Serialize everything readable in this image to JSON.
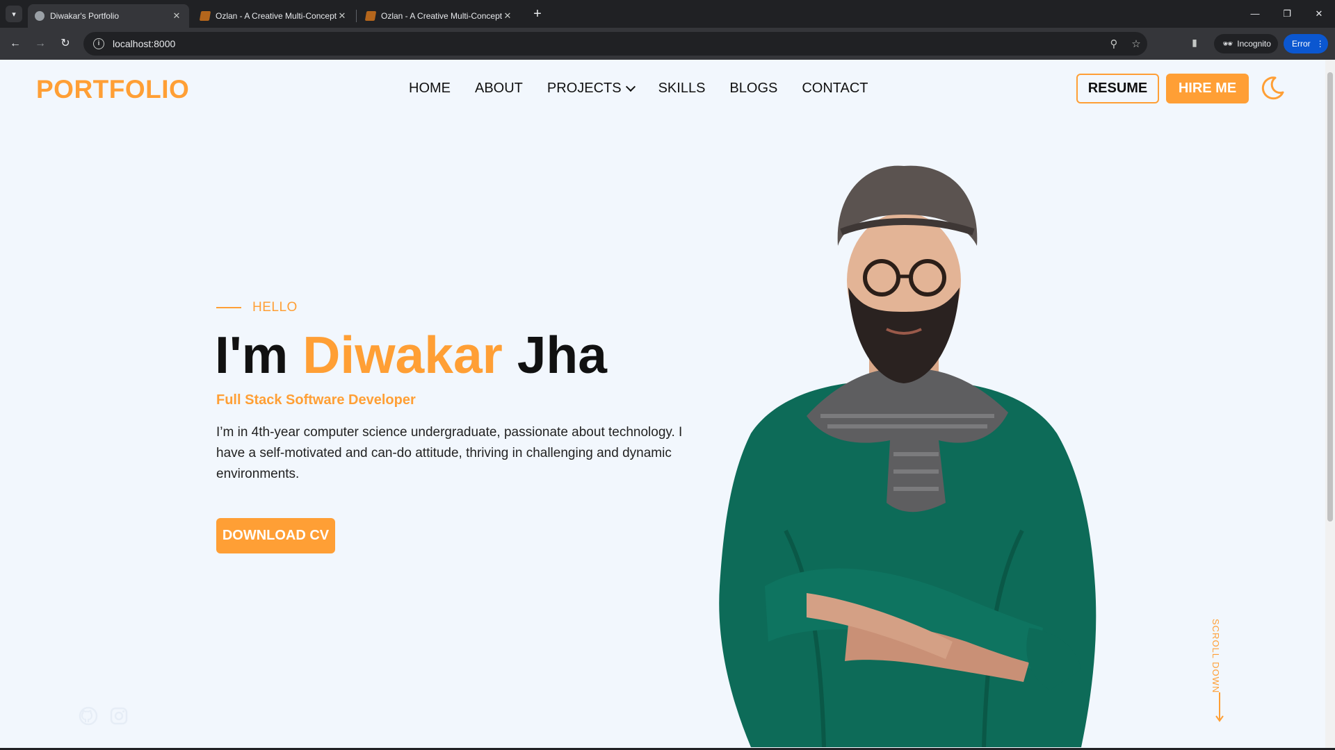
{
  "browser": {
    "tabs": [
      {
        "title": "Diwakar's Portfolio",
        "active": true
      },
      {
        "title": "Ozlan - A Creative Multi-Concept",
        "active": false
      },
      {
        "title": "Ozlan - A Creative Multi-Concept",
        "active": false
      }
    ],
    "url": "localhost:8000",
    "incognito_label": "Incognito",
    "error_label": "Error"
  },
  "header": {
    "logo": "PORTFOLIO",
    "nav": [
      "HOME",
      "ABOUT",
      "PROJECTS",
      "SKILLS",
      "BLOGS",
      "CONTACT"
    ],
    "resume_label": "RESUME",
    "hire_label": "HIRE ME"
  },
  "hero": {
    "eyebrow": "HELLO",
    "greeting": "I'm",
    "first_name": "Diwakar",
    "last_name": "Jha",
    "role": "Full Stack Software Developer",
    "bio": "I’m in 4th-year computer science undergraduate, passionate about technology. I have a self-motivated and can-do attitude, thriving in challenging and dynamic environments.",
    "cta_label": "DOWNLOAD CV",
    "scroll_label": "SCROLL DOWN"
  },
  "social": [
    "github-icon",
    "instagram-icon"
  ],
  "colors": {
    "accent": "#ff9f35",
    "page_bg": "#f2f7fd",
    "text": "#111111"
  }
}
